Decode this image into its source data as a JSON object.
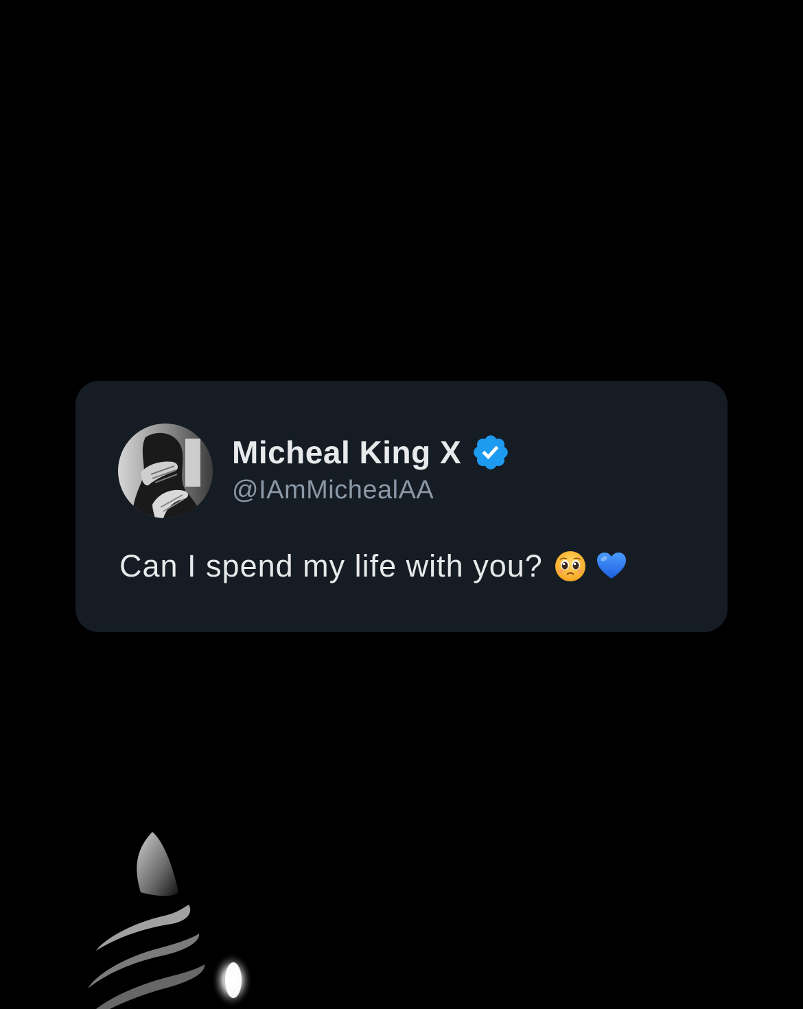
{
  "tweet": {
    "display_name": "Micheal King X",
    "handle": "@IAmMichealAA",
    "verified": true,
    "text": "Can I spend my life with you?",
    "emojis": [
      "pleading-face-emoji",
      "blue-heart-emoji"
    ]
  },
  "colors": {
    "page_background": "#000000",
    "card_background": "#151c24",
    "name_text": "#e7e9ea",
    "handle_text": "#8b98a5",
    "verified_blue": "#1d9bf0",
    "heart_blue": "#1e6fe6"
  },
  "icons": {
    "avatar": "avatar",
    "verified": "verified-badge-icon",
    "pleading_face": "pleading-face-emoji",
    "blue_heart": "blue-heart-emoji"
  }
}
